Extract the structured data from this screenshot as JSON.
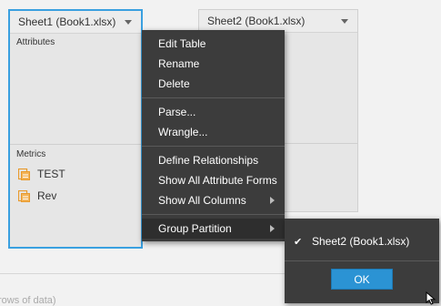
{
  "sheet1": {
    "title": "Sheet1 (Book1.xlsx)",
    "attributes_label": "Attributes",
    "metrics_label": "Metrics",
    "metrics": [
      {
        "label": "TEST",
        "icon": "metric-icon"
      },
      {
        "label": "Rev",
        "icon": "metric-icon"
      }
    ]
  },
  "sheet2": {
    "title": "Sheet2 (Book1.xlsx)"
  },
  "context_menu": {
    "items": [
      "Edit Table",
      "Rename",
      "Delete",
      "Parse...",
      "Wrangle...",
      "Define Relationships",
      "Show All Attribute Forms",
      "Show All Columns",
      "Group Partition"
    ]
  },
  "submenu": {
    "option_label": "Sheet2 (Book1.xlsx)",
    "checked": true,
    "ok_label": "OK"
  },
  "footer": {
    "rows_text": "rows of data)"
  },
  "colors": {
    "selection_border": "#3aa0e0",
    "menu_bg": "#3c3c3c",
    "ok_button": "#2b93d4",
    "metric_icon": "#e89a2c"
  }
}
